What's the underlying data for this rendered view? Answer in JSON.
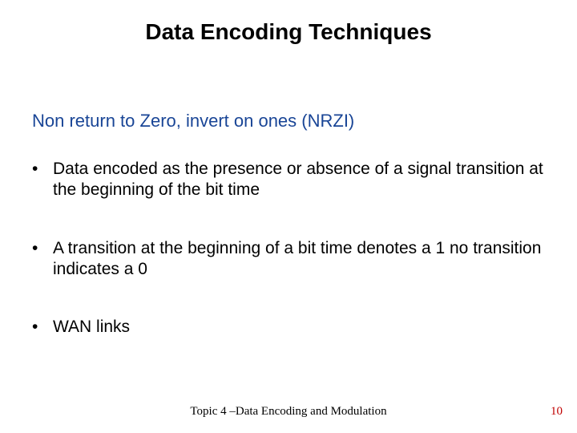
{
  "title": "Data Encoding Techniques",
  "subheading": "Non return to Zero, invert on ones (NRZI)",
  "bullets": [
    "Data encoded as the presence or absence of a signal transition at the beginning of the bit time",
    "A transition at the beginning of a bit time denotes a 1 no transition indicates a 0",
    "WAN links"
  ],
  "footer": "Topic 4 –Data Encoding and Modulation",
  "page_number": "10"
}
